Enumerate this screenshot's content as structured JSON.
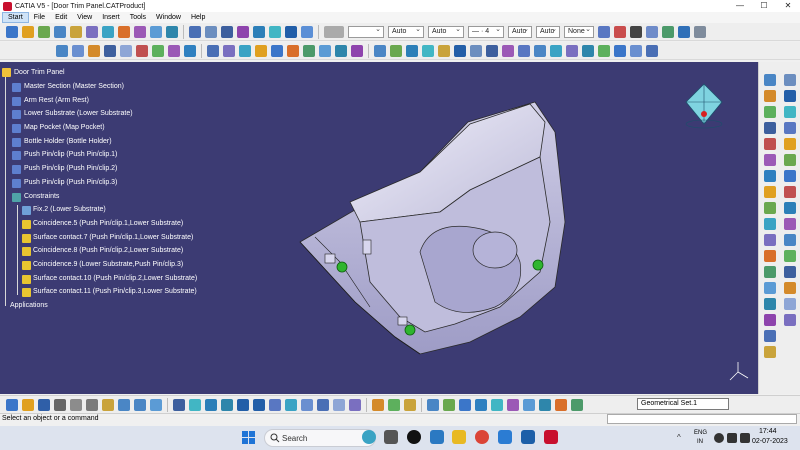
{
  "window": {
    "title": "CATIA V5 - [Door Trim Panel.CATProduct]",
    "minimize": "—",
    "maximize": "☐",
    "close": "✕"
  },
  "menu": [
    "Start",
    "File",
    "Edit",
    "View",
    "Insert",
    "Tools",
    "Window",
    "Help"
  ],
  "toolbar": {
    "combo_auto_1": "Auto",
    "combo_auto_2": "Auto",
    "combo_dash": "— · 4",
    "combo_auto_3": "Auto",
    "combo_auto_4": "Auto",
    "combo_none": "None"
  },
  "tree": {
    "root": "Door Trim Panel",
    "parts": [
      "Master Section (Master Section)",
      "Arm Rest (Arm Rest)",
      "Lower Substrate (Lower Substrate)",
      "Map Pocket (Map Pocket)",
      "Bottle Holder (Bottle Holder)",
      "Push Pin/clip (Push Pin/clip.1)",
      "Push Pin/clip (Push Pin/clip.2)",
      "Push Pin/clip (Push Pin/clip.3)"
    ],
    "constraints_label": "Constraints",
    "constraints": [
      "Fix.2 (Lower Substrate)",
      "Coincidence.5 (Push Pin/clip.1,Lower Substrate)",
      "Surface contact.7 (Push Pin/clip.1,Lower Substrate)",
      "Coincidence.8 (Push Pin/clip.2,Lower Substrate)",
      "Coincidence.9 (Lower Substrate,Push Pin/clip.3)",
      "Surface contact.10 (Push Pin/clip.2,Lower Substrate)",
      "Surface contact.11 (Push Pin/clip.3,Lower Substrate)"
    ],
    "applications_label": "Applications"
  },
  "bottom": {
    "geometrical_set": "Geometrical Set.1"
  },
  "status": {
    "message": "Select an object or a command"
  },
  "taskbar": {
    "search": "Search",
    "lang_top": "ENG",
    "lang_bottom": "IN",
    "time": "17:44",
    "date": "02-07-2023"
  },
  "colors": {
    "viewport_bg": "#3c3b73",
    "part_fill": "#d9d7ee",
    "clip_green": "#2fb52f"
  }
}
